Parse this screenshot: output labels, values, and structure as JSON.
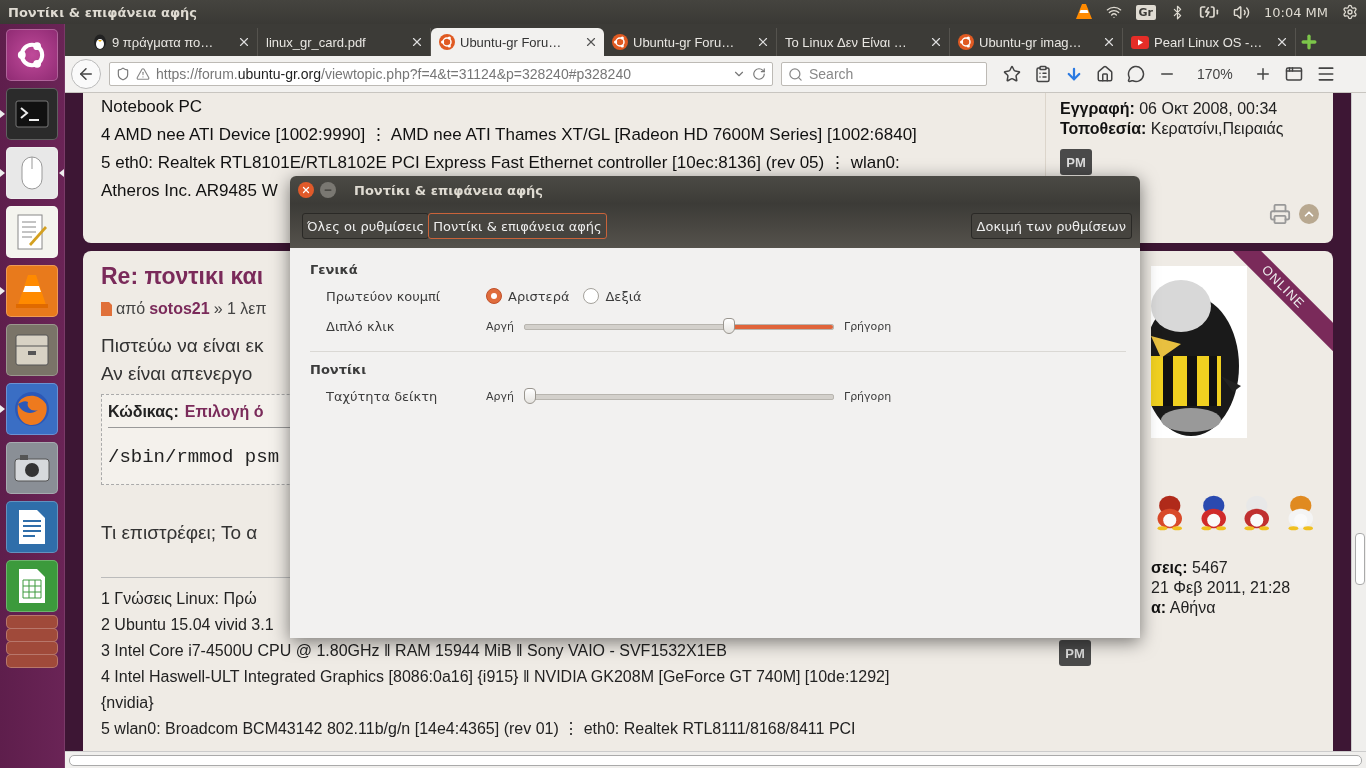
{
  "top_panel": {
    "title": "Ποντίκι & επιφάνεια αφής",
    "keyboard": "Gr",
    "clock": "10:04 ΜΜ"
  },
  "launcher": {
    "items": [
      {
        "kind": "dash",
        "running": false,
        "focused": false
      },
      {
        "kind": "terminal",
        "running": true,
        "focused": false
      },
      {
        "kind": "mouse",
        "running": true,
        "focused": true
      },
      {
        "kind": "editor",
        "running": false,
        "focused": false
      },
      {
        "kind": "vlc",
        "running": true,
        "focused": false
      },
      {
        "kind": "files",
        "running": false,
        "focused": false
      },
      {
        "kind": "firefox",
        "running": true,
        "focused": false
      },
      {
        "kind": "camera",
        "running": false,
        "focused": false
      },
      {
        "kind": "writer",
        "running": false,
        "focused": false
      },
      {
        "kind": "calc",
        "running": false,
        "focused": false
      },
      {
        "kind": "folded",
        "running": false,
        "focused": false
      },
      {
        "kind": "folded",
        "running": false,
        "focused": false
      },
      {
        "kind": "folded",
        "running": false,
        "focused": false
      },
      {
        "kind": "folded",
        "running": false,
        "focused": false
      }
    ]
  },
  "browser": {
    "tabs": [
      {
        "title": "9 πράγματα πο…",
        "kind": "tux",
        "selected": false
      },
      {
        "title": "linux_gr_card.pdf",
        "kind": "plain",
        "selected": false
      },
      {
        "title": "Ubuntu-gr Foru…",
        "kind": "ubuntu",
        "selected": true
      },
      {
        "title": "Ubuntu-gr Foru…",
        "kind": "ubuntu",
        "selected": false
      },
      {
        "title": "Το Linux Δεν Είναι …",
        "kind": "plain",
        "selected": false
      },
      {
        "title": "Ubuntu-gr imag…",
        "kind": "ubuntu",
        "selected": false
      },
      {
        "title": "Pearl Linux OS -…",
        "kind": "video",
        "selected": false
      }
    ],
    "url": "https://forum.**ubuntu-gr.org**/viewtopic.php?f=4&t=31124&p=328240#p328240",
    "search_placeholder": "Search",
    "zoom": "170%"
  },
  "posts": [
    {
      "body": [
        "Notebook PC",
        "4 AMD nee ATI Device [1002:9990] ⋮ AMD nee ATI Thames XT/GL [Radeon HD 7600M Series] [1002:6840]",
        "5 eth0: Realtek RTL8101E/RTL8102E PCI Express Fast Ethernet controller [10ec:8136] (rev 05) ⋮ wlan0:",
        "Atheros Inc. AR9485 W"
      ],
      "profile": [
        "**Εγγραφή:** 06 Οκτ 2008, 00:34",
        "**Τοποθεσία:** Κερατσίνι,Πειραιάς"
      ],
      "pm": "PM"
    },
    {
      "title": "Re: ποντικι και",
      "author_prefix": "από",
      "author": "sotos21",
      "time": "» 1 λεπ",
      "body": [
        "Πιστεύω να είναι εκ",
        "Αν είναι απενεργο"
      ],
      "code_label": "Κώδικας:",
      "code_link": "Επιλογή ό",
      "code": "/sbin/rmmod psm",
      "after": "Τι επιστρέφει; Το α",
      "signature": [
        "1 Γνώσεις Linux: Πρώ",
        "2 Ubuntu 15.04 vivid 3.1",
        "3 Intel Core i7-4500U CPU @ 1.80GHz ‖ RAM 15944 MiB ‖ Sony VAIO - SVF1532X1EB",
        "4 Intel Haswell-ULT Integrated Graphics [8086:0a16] {i915} ‖ NVIDIA GK208M [GeForce GT 740M] [10de:1292]",
        "{nvidia}",
        "5 wlan0: Broadcom BCM43142 802.11b/g/n [14e4:4365] (rev 01) ⋮ eth0: Realtek RTL8111/8168/8411 PCI"
      ],
      "badge": "ONLINE",
      "avatar": {
        "kind": "picture"
      },
      "ranks": [
        {
          "kind": "picture"
        },
        {
          "kind": "picture"
        },
        {
          "kind": "picture"
        },
        {
          "kind": "picture"
        }
      ],
      "profile": [
        "**σεις:** 5467",
        "21 Φεβ 2011, 21:28",
        "**α:** Αθήνα"
      ],
      "pm": "PM"
    }
  ],
  "dialog": {
    "title": "Ποντίκι & επιφάνεια αφής",
    "breadcrumbs": [
      {
        "label": "Όλες οι ρυθμίσεις",
        "selected": false
      },
      {
        "label": "Ποντίκι & επιφάνεια αφής",
        "selected": true
      }
    ],
    "test_button": "Δοκιμή των ρυθμίσεων",
    "sections": [
      {
        "heading": "Γενικά",
        "rows": [
          {
            "kind": "radio",
            "label": "Πρωτεύον κουμπί",
            "options": [
              {
                "label": "Αριστερά",
                "selected": true
              },
              {
                "label": "Δεξιά",
                "selected": false
              }
            ]
          },
          {
            "kind": "slider",
            "label": "Διπλό κλικ",
            "min_label": "Αργή",
            "max_label": "Γρήγορη",
            "level": 0.66,
            "inverted": true
          }
        ]
      },
      {
        "heading": "Ποντίκι",
        "rows": [
          {
            "kind": "slider",
            "label": "Ταχύτητα δείκτη",
            "min_label": "Αργή",
            "max_label": "Γρήγορη",
            "level": 0.02,
            "inverted": false
          }
        ]
      }
    ]
  }
}
